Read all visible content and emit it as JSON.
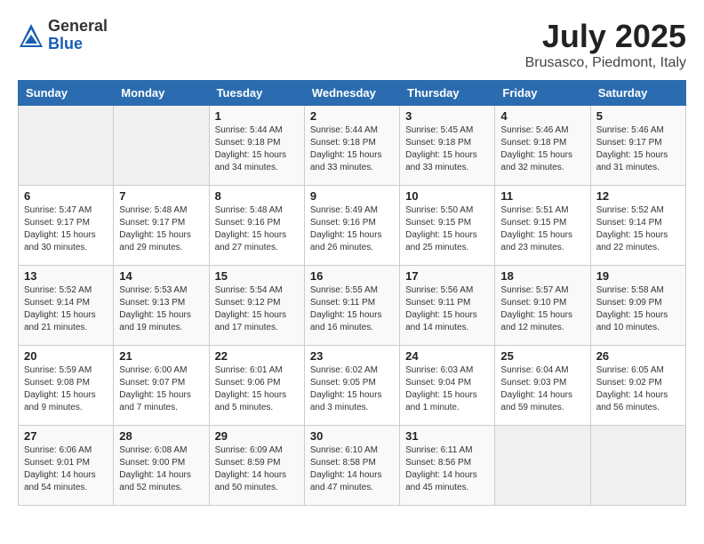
{
  "header": {
    "logo_general": "General",
    "logo_blue": "Blue",
    "title": "July 2025",
    "location": "Brusasco, Piedmont, Italy"
  },
  "columns": [
    "Sunday",
    "Monday",
    "Tuesday",
    "Wednesday",
    "Thursday",
    "Friday",
    "Saturday"
  ],
  "weeks": [
    [
      {
        "day": "",
        "detail": ""
      },
      {
        "day": "",
        "detail": ""
      },
      {
        "day": "1",
        "detail": "Sunrise: 5:44 AM\nSunset: 9:18 PM\nDaylight: 15 hours\nand 34 minutes."
      },
      {
        "day": "2",
        "detail": "Sunrise: 5:44 AM\nSunset: 9:18 PM\nDaylight: 15 hours\nand 33 minutes."
      },
      {
        "day": "3",
        "detail": "Sunrise: 5:45 AM\nSunset: 9:18 PM\nDaylight: 15 hours\nand 33 minutes."
      },
      {
        "day": "4",
        "detail": "Sunrise: 5:46 AM\nSunset: 9:18 PM\nDaylight: 15 hours\nand 32 minutes."
      },
      {
        "day": "5",
        "detail": "Sunrise: 5:46 AM\nSunset: 9:17 PM\nDaylight: 15 hours\nand 31 minutes."
      }
    ],
    [
      {
        "day": "6",
        "detail": "Sunrise: 5:47 AM\nSunset: 9:17 PM\nDaylight: 15 hours\nand 30 minutes."
      },
      {
        "day": "7",
        "detail": "Sunrise: 5:48 AM\nSunset: 9:17 PM\nDaylight: 15 hours\nand 29 minutes."
      },
      {
        "day": "8",
        "detail": "Sunrise: 5:48 AM\nSunset: 9:16 PM\nDaylight: 15 hours\nand 27 minutes."
      },
      {
        "day": "9",
        "detail": "Sunrise: 5:49 AM\nSunset: 9:16 PM\nDaylight: 15 hours\nand 26 minutes."
      },
      {
        "day": "10",
        "detail": "Sunrise: 5:50 AM\nSunset: 9:15 PM\nDaylight: 15 hours\nand 25 minutes."
      },
      {
        "day": "11",
        "detail": "Sunrise: 5:51 AM\nSunset: 9:15 PM\nDaylight: 15 hours\nand 23 minutes."
      },
      {
        "day": "12",
        "detail": "Sunrise: 5:52 AM\nSunset: 9:14 PM\nDaylight: 15 hours\nand 22 minutes."
      }
    ],
    [
      {
        "day": "13",
        "detail": "Sunrise: 5:52 AM\nSunset: 9:14 PM\nDaylight: 15 hours\nand 21 minutes."
      },
      {
        "day": "14",
        "detail": "Sunrise: 5:53 AM\nSunset: 9:13 PM\nDaylight: 15 hours\nand 19 minutes."
      },
      {
        "day": "15",
        "detail": "Sunrise: 5:54 AM\nSunset: 9:12 PM\nDaylight: 15 hours\nand 17 minutes."
      },
      {
        "day": "16",
        "detail": "Sunrise: 5:55 AM\nSunset: 9:11 PM\nDaylight: 15 hours\nand 16 minutes."
      },
      {
        "day": "17",
        "detail": "Sunrise: 5:56 AM\nSunset: 9:11 PM\nDaylight: 15 hours\nand 14 minutes."
      },
      {
        "day": "18",
        "detail": "Sunrise: 5:57 AM\nSunset: 9:10 PM\nDaylight: 15 hours\nand 12 minutes."
      },
      {
        "day": "19",
        "detail": "Sunrise: 5:58 AM\nSunset: 9:09 PM\nDaylight: 15 hours\nand 10 minutes."
      }
    ],
    [
      {
        "day": "20",
        "detail": "Sunrise: 5:59 AM\nSunset: 9:08 PM\nDaylight: 15 hours\nand 9 minutes."
      },
      {
        "day": "21",
        "detail": "Sunrise: 6:00 AM\nSunset: 9:07 PM\nDaylight: 15 hours\nand 7 minutes."
      },
      {
        "day": "22",
        "detail": "Sunrise: 6:01 AM\nSunset: 9:06 PM\nDaylight: 15 hours\nand 5 minutes."
      },
      {
        "day": "23",
        "detail": "Sunrise: 6:02 AM\nSunset: 9:05 PM\nDaylight: 15 hours\nand 3 minutes."
      },
      {
        "day": "24",
        "detail": "Sunrise: 6:03 AM\nSunset: 9:04 PM\nDaylight: 15 hours\nand 1 minute."
      },
      {
        "day": "25",
        "detail": "Sunrise: 6:04 AM\nSunset: 9:03 PM\nDaylight: 14 hours\nand 59 minutes."
      },
      {
        "day": "26",
        "detail": "Sunrise: 6:05 AM\nSunset: 9:02 PM\nDaylight: 14 hours\nand 56 minutes."
      }
    ],
    [
      {
        "day": "27",
        "detail": "Sunrise: 6:06 AM\nSunset: 9:01 PM\nDaylight: 14 hours\nand 54 minutes."
      },
      {
        "day": "28",
        "detail": "Sunrise: 6:08 AM\nSunset: 9:00 PM\nDaylight: 14 hours\nand 52 minutes."
      },
      {
        "day": "29",
        "detail": "Sunrise: 6:09 AM\nSunset: 8:59 PM\nDaylight: 14 hours\nand 50 minutes."
      },
      {
        "day": "30",
        "detail": "Sunrise: 6:10 AM\nSunset: 8:58 PM\nDaylight: 14 hours\nand 47 minutes."
      },
      {
        "day": "31",
        "detail": "Sunrise: 6:11 AM\nSunset: 8:56 PM\nDaylight: 14 hours\nand 45 minutes."
      },
      {
        "day": "",
        "detail": ""
      },
      {
        "day": "",
        "detail": ""
      }
    ]
  ]
}
